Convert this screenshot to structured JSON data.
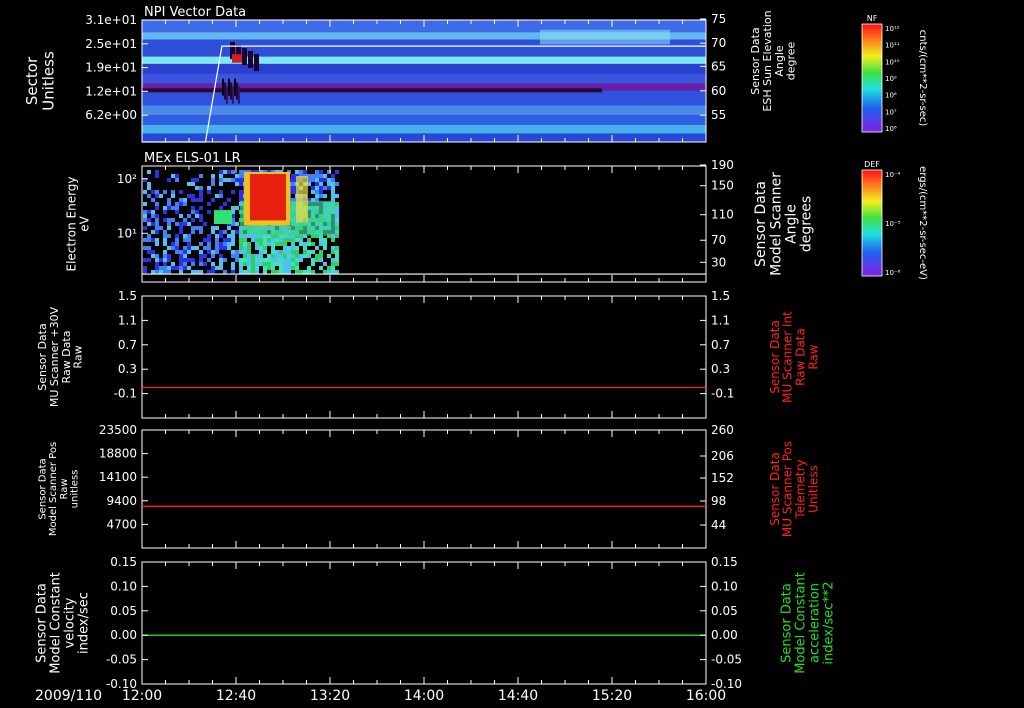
{
  "chart_data": [
    {
      "type": "heatmap",
      "title": "NPI Vector Data",
      "ylabel": "Sector\nUnitless",
      "y_ticks": [
        "3.1e+01",
        "2.5e+01",
        "1.9e+01",
        "1.2e+01",
        "6.2e+00"
      ],
      "y2label": "Sensor Data\nESH Sun Elevation\nAngle\ndegree",
      "y2_ticks": [
        "75",
        "70",
        "65",
        "60",
        "55"
      ],
      "colorbar": {
        "label": "NF",
        "unit": "cnts/(cm**2-sr-sec)",
        "ticks": [
          "10¹²",
          "10¹¹",
          "10¹⁰",
          "10⁹",
          "10⁸",
          "10⁷",
          "10⁶"
        ]
      },
      "overlay_line": {
        "x": [
          "12:00",
          "12:27",
          "12:34",
          "16:00"
        ],
        "y": [
          47,
          47,
          69,
          69
        ]
      }
    },
    {
      "type": "heatmap",
      "title": "MEx ELS-01 LR",
      "ylabel": "Electron Energy\neV",
      "y_ticks": [
        "10²",
        "10¹"
      ],
      "y2label": "Sensor Data\nModel Scanner\nAngle\ndegrees",
      "y2_ticks": [
        "190",
        "150",
        "110",
        "70",
        "30"
      ],
      "colorbar": {
        "label": "DEF",
        "unit": "ergs/(cm**2-sr-sec-eV)",
        "ticks": [
          "10⁻⁴",
          "10⁻⁵",
          "10⁻⁶"
        ]
      },
      "overlay_line": {
        "x": [
          "12:00",
          "16:00"
        ],
        "y": [
          13,
          13
        ]
      }
    },
    {
      "type": "line",
      "ylabel": "Sensor Data\nMU Scanner +30V\nRaw Data\nRaw",
      "y_ticks": [
        "1.5",
        "1.1",
        "0.7",
        "0.3",
        "-0.1"
      ],
      "ylim": [
        -0.5,
        1.5
      ],
      "y2label": "Sensor Data\nMU Scanner Int\nRaw Data\nRaw",
      "y2_ticks": [
        "1.5",
        "1.1",
        "0.7",
        "0.3",
        "-0.1"
      ],
      "series": [
        {
          "color": "#ff2020",
          "x": [
            "12:00",
            "16:00"
          ],
          "y": [
            0.0,
            0.0
          ]
        }
      ]
    },
    {
      "type": "line",
      "ylabel": "Sensor Data\nModel Scanner Pos\nRaw\nunitless",
      "y_ticks": [
        "23500",
        "18800",
        "14100",
        "9400",
        "4700"
      ],
      "ylim": [
        0,
        23500
      ],
      "y2label": "Sensor Data\nMU Scanner Pos\nTelemetry\nUnitless",
      "y2_ticks": [
        "260",
        "206",
        "152",
        "98",
        "44"
      ],
      "series": [
        {
          "color": "#ff2020",
          "x": [
            "12:00",
            "16:00"
          ],
          "y": [
            8300,
            8300
          ]
        }
      ]
    },
    {
      "type": "line",
      "ylabel": "Sensor Data\nModel Constant\nvelocity\nindex/sec",
      "y_ticks": [
        "0.15",
        "0.10",
        "0.05",
        "0.00",
        "-0.05",
        "-0.10"
      ],
      "ylim": [
        -0.1,
        0.15
      ],
      "y2label": "Sensor Data\nModel Constant\nacceleration\nindex/sec**2",
      "y2_ticks": [
        "0.15",
        "0.10",
        "0.05",
        "0.00",
        "-0.05",
        "-0.10"
      ],
      "series": [
        {
          "color": "#20e020",
          "x": [
            "12:00",
            "16:00"
          ],
          "y": [
            0.0,
            0.0
          ]
        }
      ]
    }
  ],
  "time_axis": {
    "date_label": "2009/110",
    "ticks": [
      "12:00",
      "12:40",
      "13:20",
      "14:00",
      "14:40",
      "15:20",
      "16:00"
    ]
  },
  "colors": {
    "right_label_red": "#ff2020",
    "right_label_green": "#20e020"
  }
}
